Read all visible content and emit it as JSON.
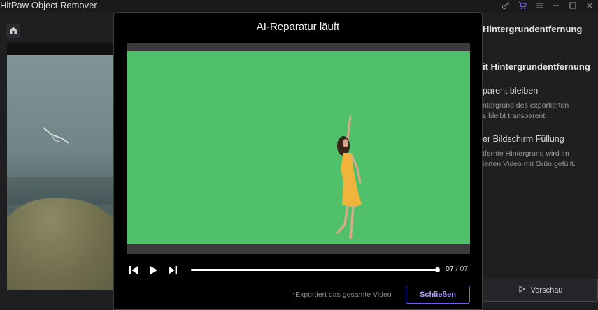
{
  "app": {
    "title": "HitPaw Object Remover"
  },
  "window_controls": {
    "icons": [
      "key-icon",
      "cart-icon",
      "menu-icon",
      "minimize-icon",
      "maximize-icon",
      "close-icon"
    ]
  },
  "right_panel": {
    "heading": "Hintergrundentfernung",
    "subheading": "it Hintergrundentfernung",
    "option1_title": "parent bleiben",
    "option1_desc_line1": "ntergrund des exportierten",
    "option1_desc_line2": "s bleibt transparent.",
    "option2_title": "er Bildschirm Füllung",
    "option2_desc_line1": "tfernte Hintergrund wird im",
    "option2_desc_line2": "ierten Video mit Grün gefüllt.",
    "preview_label": "Vorschau"
  },
  "modal": {
    "title": "AI-Reparatur läuft",
    "video_background_color": "#50c06a",
    "progress": 1.0,
    "frame_current": "07",
    "frame_separator": "/",
    "frame_total": "07",
    "footnote": "*Exportiert das gesamte Video",
    "close_label": "Schließen",
    "accent_color": "#6c63ff"
  }
}
